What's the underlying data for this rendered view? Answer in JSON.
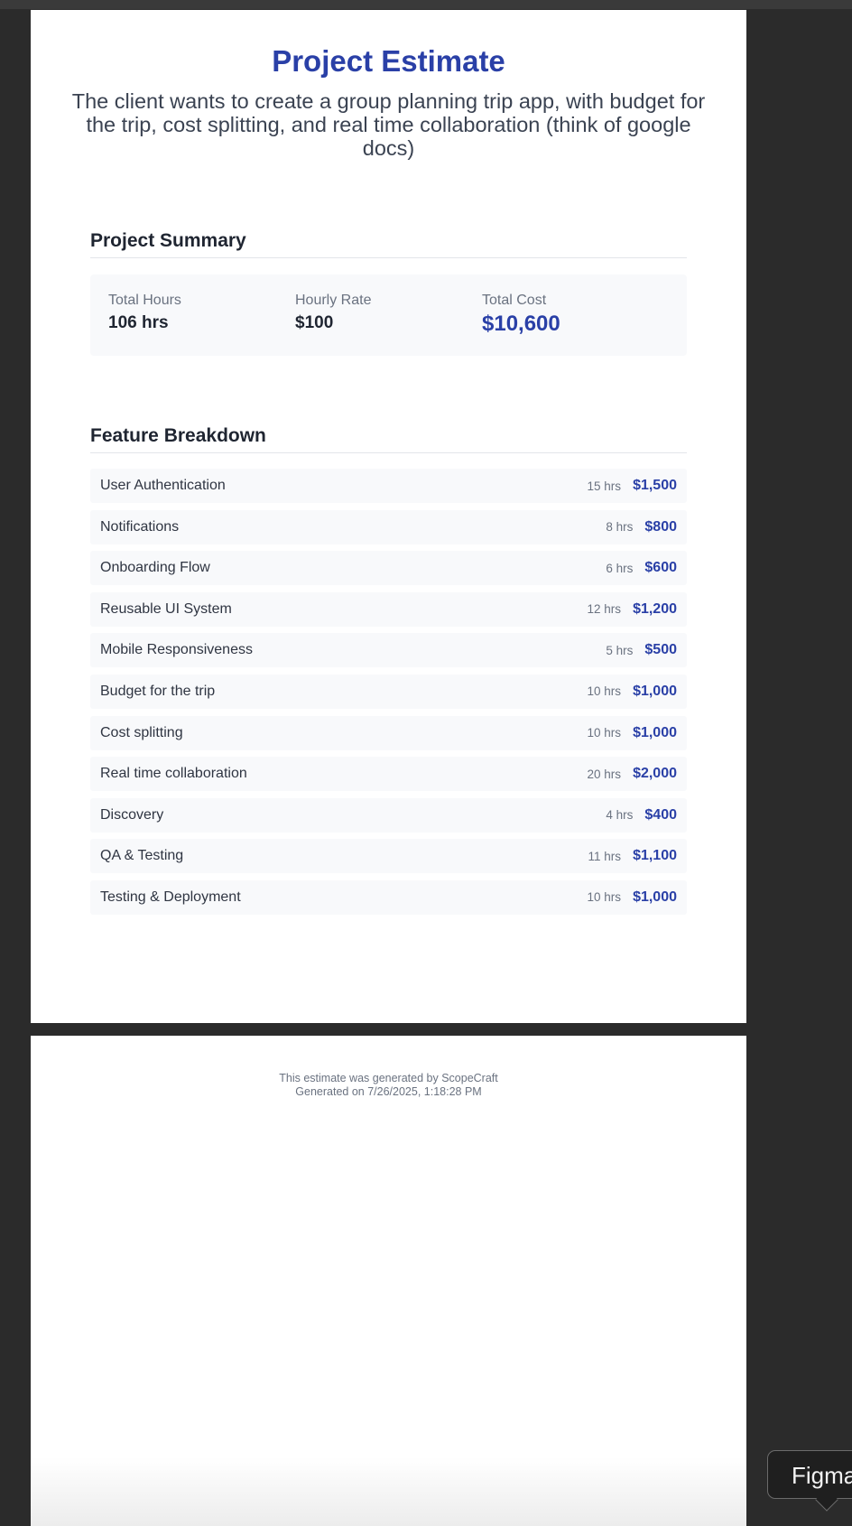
{
  "estimate": {
    "title": "Project Estimate",
    "description": "The client wants to create a group planning trip app, with budget for the trip, cost splitting, and real time collaboration (think of google docs)"
  },
  "summary": {
    "heading": "Project Summary",
    "total_hours_label": "Total Hours",
    "total_hours_value": "106 hrs",
    "hourly_rate_label": "Hourly Rate",
    "hourly_rate_value": "$100",
    "total_cost_label": "Total Cost",
    "total_cost_value": "$10,600"
  },
  "breakdown": {
    "heading": "Feature Breakdown",
    "items": [
      {
        "name": "User Authentication",
        "hours": "15 hrs",
        "cost": "$1,500"
      },
      {
        "name": "Notifications",
        "hours": "8 hrs",
        "cost": "$800"
      },
      {
        "name": "Onboarding Flow",
        "hours": "6 hrs",
        "cost": "$600"
      },
      {
        "name": "Reusable UI System",
        "hours": "12 hrs",
        "cost": "$1,200"
      },
      {
        "name": "Mobile Responsiveness",
        "hours": "5 hrs",
        "cost": "$500"
      },
      {
        "name": "Budget for the trip",
        "hours": "10 hrs",
        "cost": "$1,000"
      },
      {
        "name": "Cost splitting",
        "hours": "10 hrs",
        "cost": "$1,000"
      },
      {
        "name": "Real time collaboration",
        "hours": "20 hrs",
        "cost": "$2,000"
      },
      {
        "name": "Discovery",
        "hours": "4 hrs",
        "cost": "$400"
      },
      {
        "name": "QA & Testing",
        "hours": "11 hrs",
        "cost": "$1,100"
      },
      {
        "name": "Testing & Deployment",
        "hours": "10 hrs",
        "cost": "$1,000"
      }
    ]
  },
  "footer": {
    "generated_by": "This estimate was generated by ScopeCraft",
    "generated_on": "Generated on 7/26/2025, 1:18:28 PM"
  },
  "figma_tooltip": {
    "label": "Figma"
  },
  "colors": {
    "accent": "#2a40a7",
    "row_background": "#f8f9fb",
    "viewer_background": "#2b2b2b"
  }
}
